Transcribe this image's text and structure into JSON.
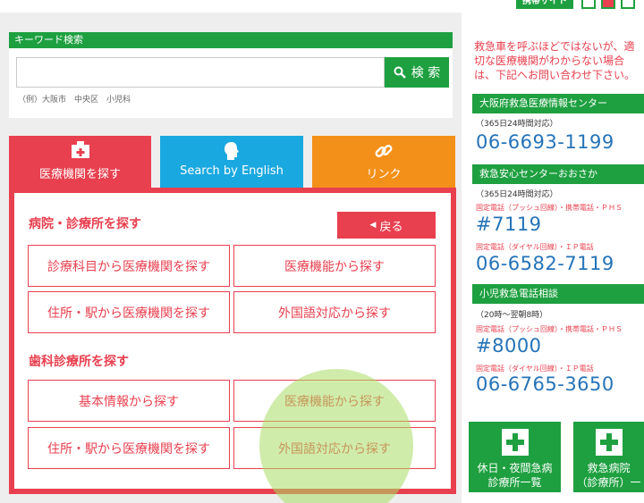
{
  "topbar": {
    "mobile_site_label": "携帯サイト"
  },
  "search": {
    "header": "キーワード検索",
    "placeholder": "",
    "button_label": "検 索",
    "example": "（例）大阪市　中央区　小児科"
  },
  "tabs": [
    {
      "label": "医療機関を探す",
      "icon": "hospital-icon"
    },
    {
      "label": "Search by English",
      "icon": "person-head-icon"
    },
    {
      "label": "リンク",
      "icon": "chain-link-icon"
    }
  ],
  "hospital_section": {
    "title": "病院・診療所を探す",
    "back_label": "戻る",
    "options": [
      "診療科目から医療機関を探す",
      "医療機能から探す",
      "住所・駅から医療機関を探す",
      "外国語対応から探す"
    ]
  },
  "dental_section": {
    "title": "歯科診療所を探す",
    "options": [
      "基本情報から探す",
      "医療機能から探す",
      "住所・駅から医療機関を探す",
      "外国語対応から探す"
    ]
  },
  "sidebar": {
    "notice_lines": [
      "救急車を呼ぶほどではないが、適",
      "切な医療機関がわからない場合",
      "は、下記へお問い合わせ下さい。"
    ],
    "center1": {
      "title": "大阪府救急医療情報センター",
      "hours": "（365日24時間対応）",
      "phone": "06-6693-1199"
    },
    "center2": {
      "title": "救急安心センターおおさか",
      "hours": "（365日24時間対応）",
      "note1": "固定電話（プッシュ回線）・携帯電話・ＰＨＳ",
      "short_number": "#7119",
      "note2": "固定電話（ダイヤル回線）・ＩＰ電話",
      "phone": "06-6582-7119"
    },
    "center3": {
      "title": "小児救急電話相談",
      "hours": "（20時～翌朝8時）",
      "note1": "固定電話（プッシュ回線）・携帯電話・ＰＨＳ",
      "short_number": "#8000",
      "note2": "固定電話（ダイヤル回線）・ＩＰ電話",
      "phone": "06-6765-3650"
    }
  },
  "bottom_buttons": [
    {
      "line1": "休日・夜間急病",
      "line2": "診療所一覧"
    },
    {
      "line1": "救急病院",
      "line2": "（診療所）一"
    }
  ],
  "colors": {
    "green": "#1ea040",
    "red": "#e8404f",
    "blue": "#1aa8e0",
    "orange": "#f39019",
    "phone_blue": "#2573b8"
  }
}
